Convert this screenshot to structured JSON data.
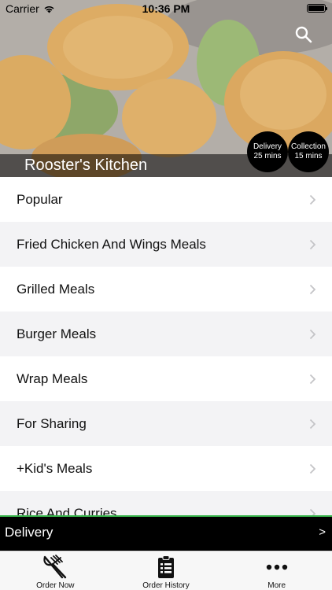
{
  "status_bar": {
    "carrier": "Carrier",
    "time": "10:36 PM"
  },
  "restaurant": {
    "name": "Rooster's Kitchen"
  },
  "badges": {
    "delivery": {
      "label": "Delivery",
      "time": "25 mins"
    },
    "collection": {
      "label": "Collection",
      "time": "15 mins"
    }
  },
  "menu": {
    "categories": [
      "Popular",
      "Fried Chicken And Wings Meals",
      "Grilled Meals",
      "Burger Meals",
      "Wrap Meals",
      "For Sharing",
      "+Kid's Meals",
      "Rice And Curries"
    ]
  },
  "order_mode": {
    "label": "Delivery",
    "arrow": ">"
  },
  "tabs": [
    {
      "label": "Order Now",
      "icon": "fork-knife-icon"
    },
    {
      "label": "Order History",
      "icon": "clipboard-list-icon"
    },
    {
      "label": "More",
      "icon": "more-dots-icon"
    }
  ],
  "colors": {
    "accent_green": "#37b34a",
    "badge_bg": "#000000"
  }
}
